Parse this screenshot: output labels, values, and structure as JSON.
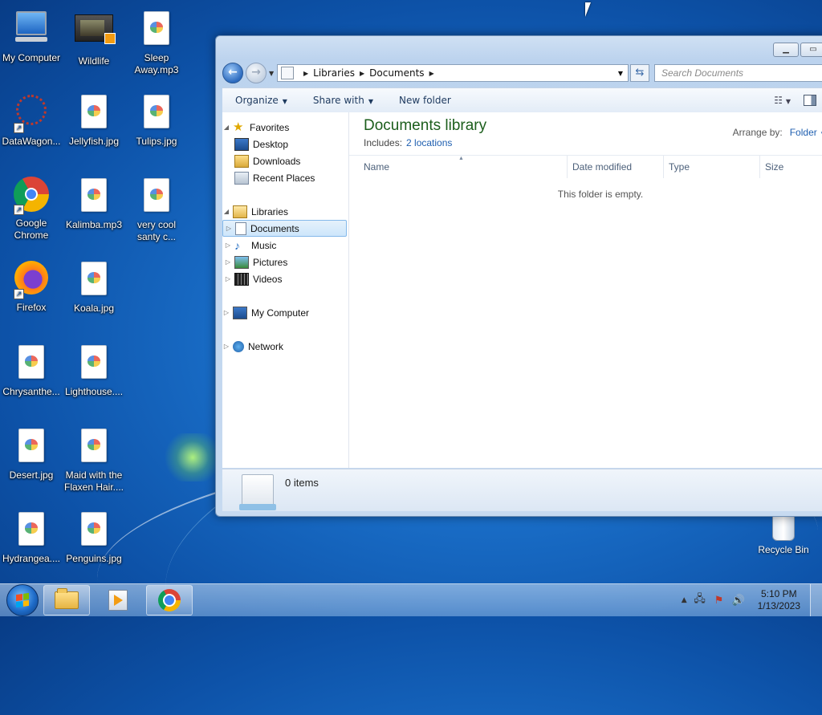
{
  "desktop": {
    "icons": [
      {
        "label": "My Computer",
        "icon": "computer-icon"
      },
      {
        "label": "Wildlife",
        "icon": "video-icon"
      },
      {
        "label": "Sleep Away.mp3",
        "icon": "media-file-icon"
      },
      {
        "label": "DataWagon...",
        "icon": "datawagon-icon"
      },
      {
        "label": "Jellyfish.jpg",
        "icon": "image-file-icon"
      },
      {
        "label": "Tulips.jpg",
        "icon": "image-file-icon"
      },
      {
        "label": "Google Chrome",
        "icon": "chrome-icon"
      },
      {
        "label": "Kalimba.mp3",
        "icon": "media-file-icon"
      },
      {
        "label": "very cool santy c...",
        "icon": "media-file-icon"
      },
      {
        "label": "Firefox",
        "icon": "firefox-icon"
      },
      {
        "label": "Koala.jpg",
        "icon": "image-file-icon"
      },
      {
        "label": "Chrysanthe...",
        "icon": "image-file-icon"
      },
      {
        "label": "Lighthouse....",
        "icon": "image-file-icon"
      },
      {
        "label": "Desert.jpg",
        "icon": "image-file-icon"
      },
      {
        "label": "Maid with the Flaxen Hair....",
        "icon": "media-file-icon"
      },
      {
        "label": "Hydrangea....",
        "icon": "image-file-icon"
      },
      {
        "label": "Penguins.jpg",
        "icon": "image-file-icon"
      }
    ],
    "recycle_bin": "Recycle Bin"
  },
  "explorer": {
    "breadcrumb": [
      "Libraries",
      "Documents"
    ],
    "search_placeholder": "Search Documents",
    "toolbar": {
      "organize": "Organize",
      "share_with": "Share with",
      "new_folder": "New folder"
    },
    "navpane": {
      "favorites": "Favorites",
      "desktop": "Desktop",
      "downloads": "Downloads",
      "recent_places": "Recent Places",
      "libraries": "Libraries",
      "documents": "Documents",
      "music": "Music",
      "pictures": "Pictures",
      "videos": "Videos",
      "my_computer": "My Computer",
      "network": "Network"
    },
    "library_title": "Documents library",
    "includes_label": "Includes:",
    "includes_link": "2 locations",
    "arrange_label": "Arrange by:",
    "arrange_value": "Folder",
    "columns": [
      "Name",
      "Date modified",
      "Type",
      "Size"
    ],
    "empty_message": "This folder is empty.",
    "status": "0 items"
  },
  "taskbar": {
    "time": "5:10 PM",
    "date": "1/13/2023"
  }
}
